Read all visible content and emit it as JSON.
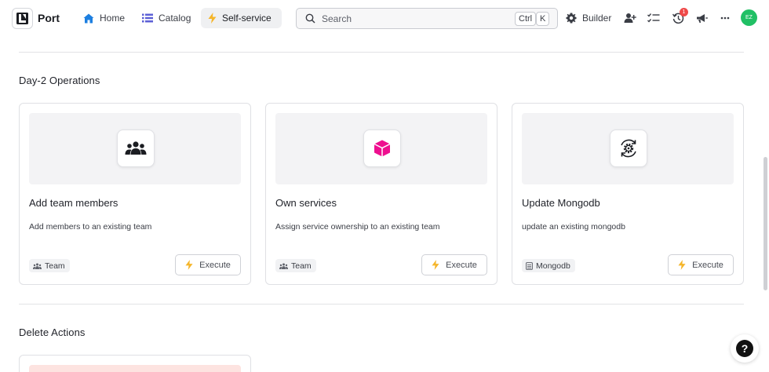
{
  "header": {
    "brand": "Port",
    "nav": [
      {
        "label": "Home",
        "icon": "home-icon"
      },
      {
        "label": "Catalog",
        "icon": "list-icon"
      },
      {
        "label": "Self-service",
        "icon": "lightning-icon"
      }
    ],
    "active_nav": "Self-service",
    "search": {
      "placeholder": "Search",
      "shortcut_keys": [
        "Ctrl",
        "K"
      ]
    },
    "builder_label": "Builder",
    "notification_count": "1",
    "avatar_initials": "EZ",
    "colors": {
      "avatar": "#21c065",
      "home_icon": "#1d7fe0",
      "catalog_icon": "#5b5fd6",
      "lightning": "#f5b52a",
      "badge": "#ef4a4a"
    }
  },
  "sections": [
    {
      "title": "Day-2 Operations",
      "cards": [
        {
          "title": "Add team members",
          "description": "Add members to an existing team",
          "tag": "Team",
          "tag_icon": "team-icon",
          "icon": "team-members-icon",
          "execute_label": "Execute"
        },
        {
          "title": "Own services",
          "description": "Assign service ownership to an existing team",
          "tag": "Team",
          "tag_icon": "team-icon",
          "icon": "cube-icon",
          "execute_label": "Execute"
        },
        {
          "title": "Update Mongodb",
          "description": "update an existing mongodb",
          "tag": "Mongodb",
          "tag_icon": "database-icon",
          "icon": "gear-refresh-icon",
          "execute_label": "Execute"
        }
      ]
    },
    {
      "title": "Delete Actions",
      "cards": []
    }
  ],
  "help_label": "?"
}
